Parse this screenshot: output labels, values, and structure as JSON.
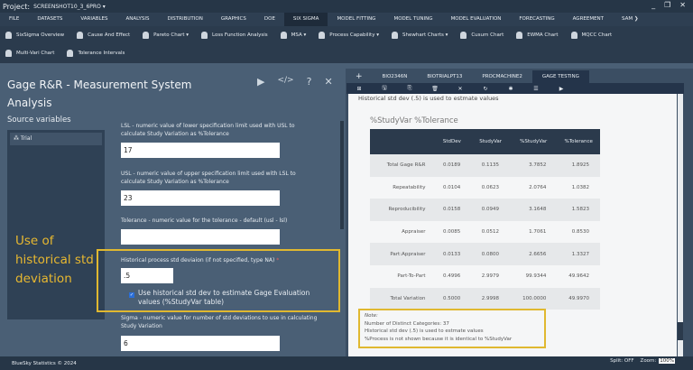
{
  "titlebar": {
    "label": "Project:",
    "project": "SCREENSHOT10_3_6PRO ▾",
    "controls": [
      "_",
      "❐",
      "✕"
    ]
  },
  "menu": [
    "FILE",
    "DATASETS",
    "VARIABLES",
    "ANALYSIS",
    "DISTRIBUTION",
    "GRAPHICS",
    "DOE",
    "SIX SIGMA",
    "MODEL FITTING",
    "MODEL TUNING",
    "MODEL EVALUATION",
    "FORECASTING",
    "AGREEMENT",
    "SAM ❯"
  ],
  "menu_active": "SIX SIGMA",
  "toolbar": {
    "row1": [
      "SixSigma Overview",
      "Cause And Effect",
      "Pareto Chart ▾",
      "Loss Function Analysis",
      "MSA ▾",
      "Process Capability ▾",
      "Shewhart Charts ▾",
      "Cusum Chart",
      "EWMA Chart",
      "MQCC Chart"
    ],
    "row2": [
      "Multi-Vari Chart",
      "Tolerance Intervals"
    ]
  },
  "dialog": {
    "title": "Gage R&R - Measurement System Analysis",
    "icons": [
      "run-icon",
      "code-icon",
      "help-icon",
      "close-icon"
    ],
    "source_label": "Source variables",
    "source_items": [
      "Trial"
    ],
    "callout": "Use of historical std deviation",
    "fields": {
      "lsl_label": "LSL - numeric value of lower specification limit used with USL to calculate Study Variation as %Tolerance",
      "lsl_value": "17",
      "usl_label": "USL - numeric value of upper specification limit used with LSL to calculate Study Variation as %Tolerance",
      "usl_value": "23",
      "tol_label": "Tolerance - numeric value for the tolerance - default (usl - lsl)",
      "tol_value": "",
      "hist_label": "Historical process std deviaion (if not specified, type NA)",
      "hist_required": "*",
      "hist_value": ".5",
      "use_hist_label": "Use historical std dev to estimate Gage Evaluation values (%StudyVar table)",
      "use_hist_checked": true,
      "sigma_label": "Sigma - numeric value for number of std deviations to use in calculating Study Variation",
      "sigma_value": "6"
    }
  },
  "output": {
    "tabs": [
      "+",
      "BIO2346N",
      "BIOTRIALPT13",
      "PROCMACHINE2",
      "GAGE TESTING"
    ],
    "active_tab": "GAGE TESTING",
    "toolbar_icons": [
      "add-icon",
      "save-icon",
      "export-icon",
      "delete-icon",
      "close-icon",
      "refresh-icon",
      "settings-icon",
      "list-icon",
      "play-icon"
    ],
    "hist_text": "Historical std dev (.5) is used to estmate values",
    "table_title": "%StudyVar %Tolerance",
    "columns": [
      "",
      "StdDev",
      "StudyVar",
      "%StudyVar",
      "%Tolerance"
    ],
    "rows": [
      [
        "Total Gage R&R",
        "0.0189",
        "0.1135",
        "3.7852",
        "1.8925"
      ],
      [
        "Repeatability",
        "0.0104",
        "0.0623",
        "2.0764",
        "1.0382"
      ],
      [
        "Reproducibility",
        "0.0158",
        "0.0949",
        "3.1648",
        "1.5823"
      ],
      [
        "Appraiser",
        "0.0085",
        "0.0512",
        "1.7061",
        "0.8530"
      ],
      [
        "Part:Appraiser",
        "0.0133",
        "0.0800",
        "2.6656",
        "1.3327"
      ],
      [
        "Part-To-Part",
        "0.4996",
        "2.9979",
        "99.9344",
        "49.9642"
      ],
      [
        "Total Variation",
        "0.5000",
        "2.9998",
        "100.0000",
        "49.9970"
      ]
    ],
    "note": [
      "Note:",
      "Number of Distinct Categories: 37",
      "Historical std dev (.5) is used to estmate values",
      "%Process is not shown because it is identical to %StudyVar"
    ]
  },
  "footer": {
    "copyright": "BlueSky Statistics © 2024",
    "split": "Split: OFF",
    "zoom_label": "Zoom:",
    "zoom_value": "100%"
  },
  "colors": {
    "highlight": "#e0b830",
    "panel": "#4a5f75",
    "dark": "#263647"
  }
}
